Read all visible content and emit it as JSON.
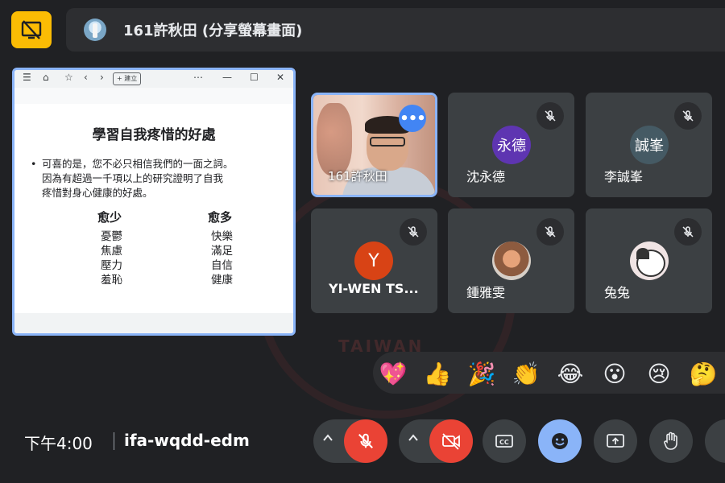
{
  "banner": {
    "title": "161許秋田 (分享螢幕畫面)"
  },
  "browser": {
    "new_tab_label": "+ 建立"
  },
  "slide": {
    "title": "學習自我疼惜的好處",
    "bullet_line1": "可喜的是，您不必只相信我們的一面之詞。",
    "bullet_line2": "因為有超過一千項以上的研究證明了自我",
    "bullet_line3": "疼惜對身心健康的好處。",
    "less_header": "愈少",
    "less_items": [
      "憂鬱",
      "焦慮",
      "壓力",
      "羞恥"
    ],
    "more_header": "愈多",
    "more_items": [
      "快樂",
      "滿足",
      "自信",
      "健康"
    ]
  },
  "participants": [
    {
      "name": "161許秋田"
    },
    {
      "name": "沈永德",
      "avatar": "永德",
      "avatar_color": "#5e35b1"
    },
    {
      "name": "李誠峯",
      "avatar": "誠峯",
      "avatar_color": "#455a64"
    },
    {
      "name": "YI-WEN TS...",
      "avatar": "Y",
      "avatar_color": "#d84315"
    },
    {
      "name": "鍾雅雯"
    },
    {
      "name": "兔兔"
    }
  ],
  "reactions": [
    "💖",
    "👍",
    "🎉",
    "👏",
    "😂",
    "😮",
    "😢",
    "🤔"
  ],
  "footer": {
    "time": "下午4:00",
    "meeting_code": "ifa-wqdd-edm"
  },
  "watermark_text": "TAIWAN",
  "icons": {
    "present": "present-stop-icon",
    "mic": "mic-off-icon",
    "camera": "camera-off-icon",
    "captions": "captions-icon",
    "emoji": "emoji-icon",
    "share": "present-screen-icon",
    "hand": "raise-hand-icon",
    "more": "more-vert-icon"
  },
  "colors": {
    "accent": "#8ab4f8",
    "danger": "#ea4335",
    "present": "#fbbc04"
  }
}
